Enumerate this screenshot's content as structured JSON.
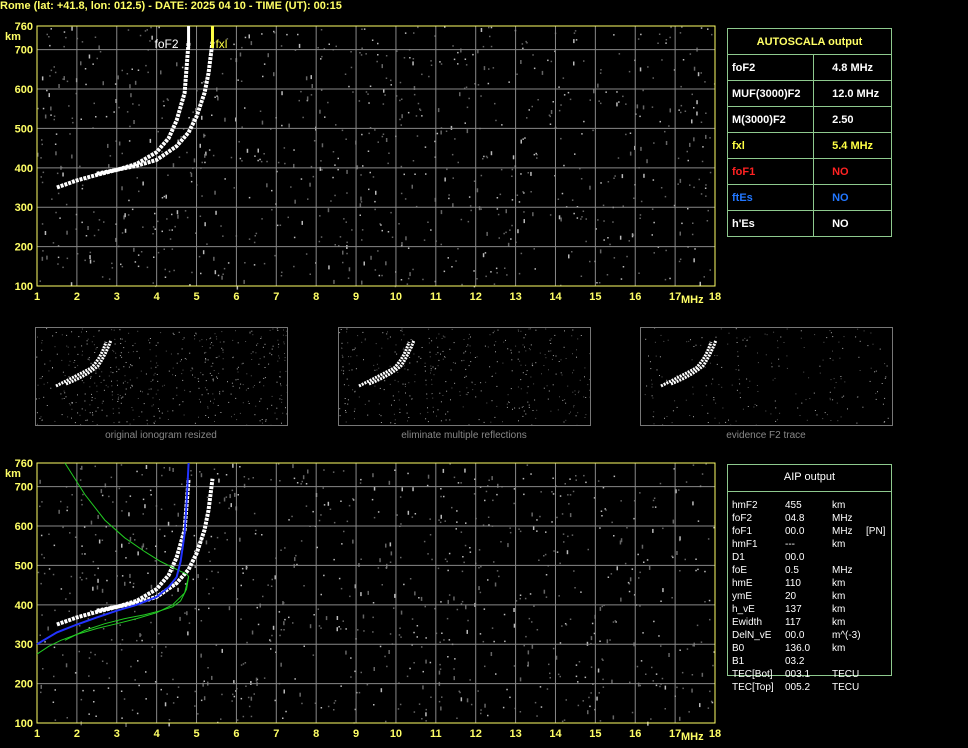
{
  "header": "Rome (lat: +41.8, lon: 012.5) - DATE: 2025 04 10 - TIME (UT): 00:15",
  "colors": {
    "grid": "#888888",
    "axis": "#ffff66",
    "trace": "#ffffff",
    "green": "#22cc22",
    "blue": "#2233ff",
    "panel_border": "#8ec98e",
    "red": "#ff2222",
    "blue_text": "#2277ff",
    "yellow": "#ffff44"
  },
  "autoscala": {
    "title": "AUTOSCALA output",
    "rows": [
      {
        "label": "foF2",
        "value": "4.8 MHz",
        "color": "#ffffff"
      },
      {
        "label": "MUF(3000)F2",
        "value": "12.0 MHz",
        "color": "#ffffff"
      },
      {
        "label": "M(3000)F2",
        "value": "2.50",
        "color": "#ffffff"
      },
      {
        "label": "fxl",
        "value": "5.4 MHz",
        "color": "#ffff44"
      },
      {
        "label": "foF1",
        "value": "NO",
        "color": "#ff2222"
      },
      {
        "label": "ftEs",
        "value": "NO",
        "color": "#2277ff"
      },
      {
        "label": "h'Es",
        "value": "NO",
        "color": "#ffffff"
      }
    ]
  },
  "aip": {
    "title": "AIP output",
    "rows": [
      [
        "hmF2",
        "455",
        "km",
        ""
      ],
      [
        "foF2",
        "04.8",
        "MHz",
        ""
      ],
      [
        "foF1",
        "00.0",
        "MHz",
        "[PN]"
      ],
      [
        "hmF1",
        "---",
        "km",
        ""
      ],
      [
        "D1",
        "00.0",
        "",
        ""
      ],
      [
        "foE",
        "0.5",
        "MHz",
        ""
      ],
      [
        "hmE",
        "110",
        "km",
        ""
      ],
      [
        "ymE",
        "20",
        "km",
        ""
      ],
      [
        "h_vE",
        "137",
        "km",
        ""
      ],
      [
        "Ewidth",
        "117",
        "km",
        ""
      ],
      [
        "DelN_vE",
        "00.0",
        "m^(-3)",
        ""
      ],
      [
        "B0",
        "136.0",
        "km",
        ""
      ],
      [
        "B1",
        "03.2",
        "",
        ""
      ],
      [
        "TEC[Bot]",
        "003.1",
        "TECU",
        ""
      ],
      [
        "TEC[Top]",
        "005.2",
        "TECU",
        ""
      ]
    ]
  },
  "thumbs": [
    {
      "caption": "original ionogram resized"
    },
    {
      "caption": "eliminate multiple reflections"
    },
    {
      "caption": "evidence F2 trace"
    }
  ],
  "chart_data": [
    {
      "type": "scatter",
      "title": "",
      "xlabel": "MHz",
      "ylabel": "km",
      "xlim": [
        1,
        18
      ],
      "ylim": [
        100,
        760
      ],
      "xticks": [
        1,
        2,
        3,
        4,
        5,
        6,
        7,
        8,
        9,
        10,
        11,
        12,
        13,
        14,
        15,
        16,
        17,
        18
      ],
      "yticks": [
        100,
        200,
        300,
        400,
        500,
        600,
        700,
        760
      ],
      "grid": true,
      "annotations": [
        {
          "text": "foF2",
          "x": 4.8,
          "color": "#ffffff"
        },
        {
          "text": "fxl",
          "x": 5.4,
          "color": "#ffff44"
        }
      ],
      "series": [
        {
          "name": "O-trace",
          "x": [
            1.5,
            2.0,
            2.5,
            3.0,
            3.5,
            4.0,
            4.3,
            4.5,
            4.7,
            4.8
          ],
          "y": [
            350,
            368,
            382,
            395,
            410,
            440,
            475,
            520,
            590,
            720
          ]
        },
        {
          "name": "X-trace",
          "x": [
            2.5,
            3.0,
            3.5,
            4.0,
            4.5,
            4.8,
            5.0,
            5.2,
            5.3,
            5.4
          ],
          "y": [
            385,
            395,
            405,
            420,
            455,
            490,
            530,
            590,
            640,
            720
          ]
        }
      ]
    },
    {
      "type": "line",
      "title": "",
      "xlabel": "MHz",
      "ylabel": "km",
      "xlim": [
        1,
        18
      ],
      "ylim": [
        100,
        760
      ],
      "xticks": [
        1,
        2,
        3,
        4,
        5,
        6,
        7,
        8,
        9,
        10,
        11,
        12,
        13,
        14,
        15,
        16,
        17,
        18
      ],
      "yticks": [
        100,
        200,
        300,
        400,
        500,
        600,
        700,
        760
      ],
      "grid": true,
      "series": [
        {
          "name": "O-trace",
          "x": [
            1.5,
            2.0,
            2.5,
            3.0,
            3.5,
            4.0,
            4.3,
            4.5,
            4.7,
            4.8
          ],
          "y": [
            350,
            368,
            382,
            395,
            410,
            440,
            475,
            520,
            590,
            720
          ]
        },
        {
          "name": "X-trace",
          "x": [
            2.5,
            3.0,
            3.5,
            4.0,
            4.5,
            4.8,
            5.0,
            5.2,
            5.3,
            5.4
          ],
          "y": [
            385,
            395,
            405,
            420,
            455,
            490,
            530,
            590,
            640,
            720
          ]
        },
        {
          "name": "profile",
          "x": [
            1.7,
            2.2,
            2.7,
            3.2,
            3.7,
            4.1,
            4.4,
            4.6,
            4.75,
            4.8,
            4.75,
            4.6,
            4.4,
            4.1,
            3.7,
            3.2,
            2.7,
            2.2,
            1.7
          ],
          "y": [
            760,
            680,
            615,
            570,
            535,
            510,
            495,
            485,
            478,
            472,
            440,
            410,
            395,
            385,
            375,
            365,
            352,
            335,
            310
          ]
        },
        {
          "name": "profile-lower",
          "x": [
            1.0,
            1.3,
            1.6,
            2.0,
            2.5,
            3.0,
            3.5,
            4.0,
            4.4,
            4.7,
            4.8
          ],
          "y": [
            275,
            295,
            310,
            325,
            340,
            352,
            365,
            380,
            400,
            430,
            472
          ]
        },
        {
          "name": "fit",
          "x": [
            1.0,
            1.5,
            2.0,
            2.5,
            3.0,
            3.5,
            4.0,
            4.3,
            4.5,
            4.6,
            4.7,
            4.75,
            4.8
          ],
          "y": [
            300,
            330,
            350,
            368,
            385,
            400,
            420,
            445,
            470,
            510,
            580,
            660,
            760
          ]
        }
      ]
    }
  ]
}
